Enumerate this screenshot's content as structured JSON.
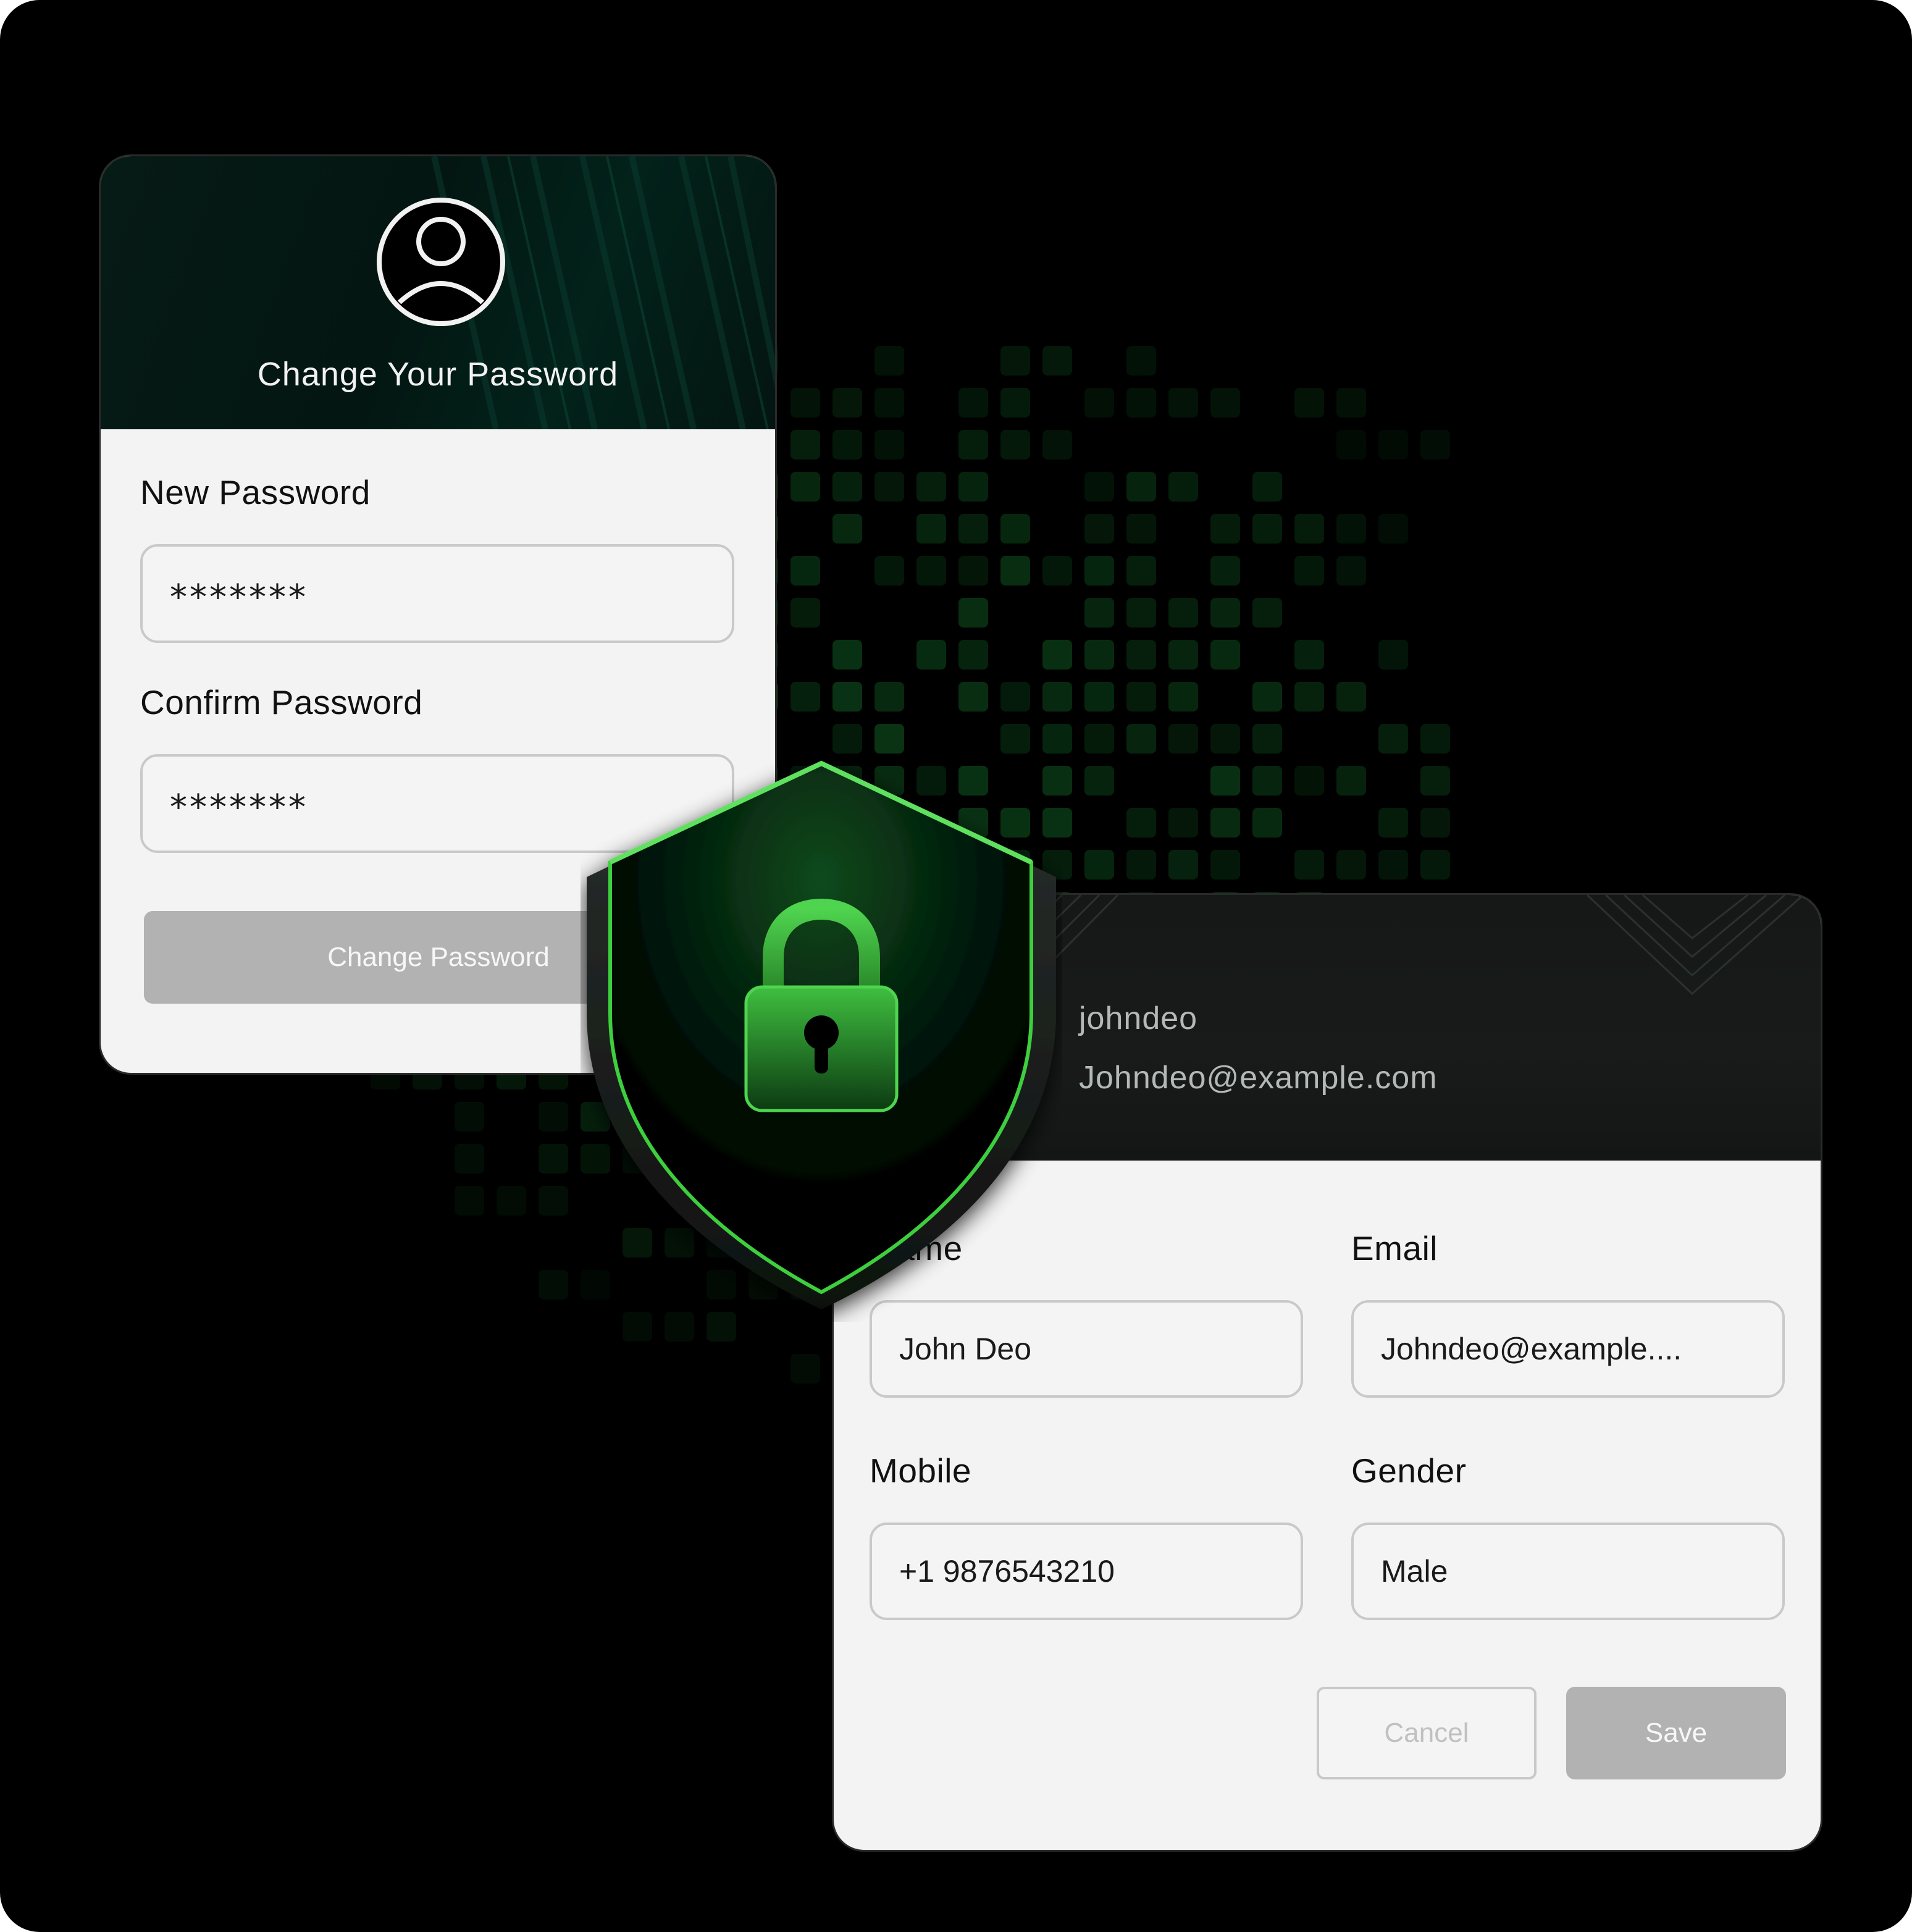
{
  "password_card": {
    "title": "Change Your Password",
    "new_password_label": "New Password",
    "new_password_value": "*******",
    "confirm_password_label": "Confirm Password",
    "confirm_password_value": "*******",
    "submit_label": "Change Password"
  },
  "profile_card": {
    "username": "johndeo",
    "email": "Johndeo@example.com",
    "name_label": "Name",
    "name_value": "John Deo",
    "email_label": "Email",
    "email_value": "Johndeo@example....",
    "mobile_label": "Mobile",
    "mobile_value": "+1 9876543210",
    "gender_label": "Gender",
    "gender_value": "Male",
    "cancel_label": "Cancel",
    "save_label": "Save"
  },
  "icons": {
    "avatar": "user-circle-icon",
    "shield": "shield-icon",
    "lock": "padlock-icon"
  },
  "colors": {
    "background": "#000000",
    "accent_green": "#3ccf3c",
    "card_bg": "#f3f3f3",
    "button_gray": "#b2b2b2",
    "header_dark_green": "#041a15",
    "header_dark": "#161918"
  }
}
